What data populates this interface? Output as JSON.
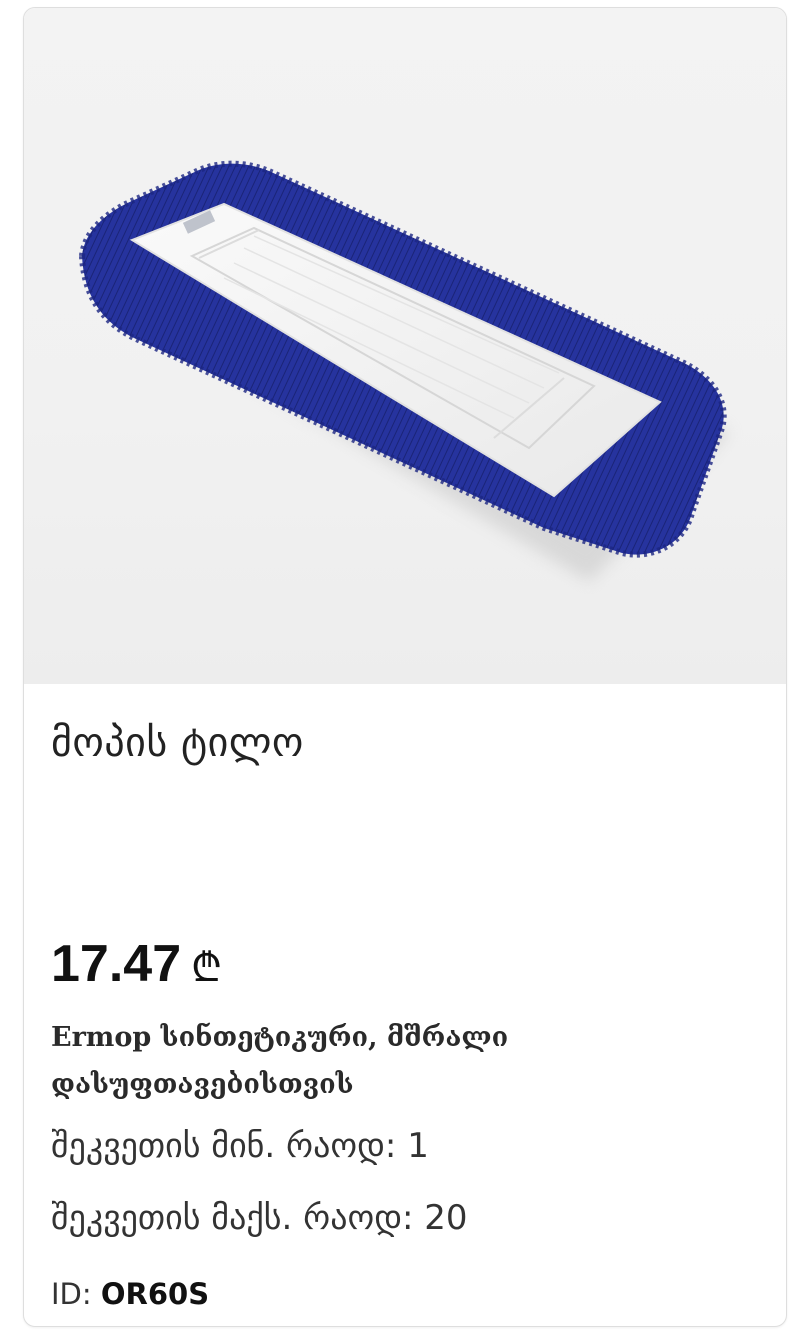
{
  "product": {
    "title": "მოპის ტილო",
    "price": "17.47",
    "currency_symbol": "₾",
    "description": "Ermop სინთეტიკური, მშრალი დასუფთავებისთვის",
    "min_order_label": "შეკვეთის მინ. რაოდ:",
    "min_order_value": "1",
    "max_order_label": "შეკვეთის მაქს. რაოდ:",
    "max_order_value": "20",
    "id_label": "ID:",
    "id_value": "OR60S"
  },
  "image": {
    "icon": "mop-pad-photo",
    "fringe_color": "#24329a",
    "pad_color": "#f4f4f4"
  }
}
